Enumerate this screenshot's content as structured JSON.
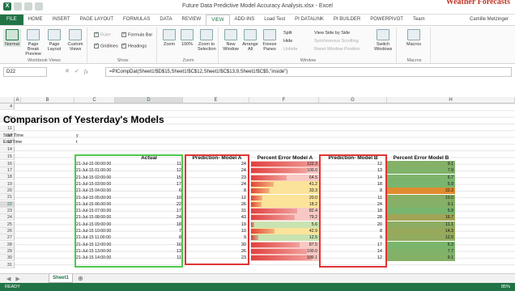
{
  "window": {
    "title": "Future Data Predictive Model Accuracy Analysis.xlsx - Excel",
    "watermark": "Weather Forecasts",
    "user": "Camille Metzinger"
  },
  "ribbon_tabs": [
    "HOME",
    "INSERT",
    "PAGE LAYOUT",
    "FORMULAS",
    "DATA",
    "REVIEW",
    "VIEW",
    "ADD-INS",
    "Load Test",
    "PI DATALINK",
    "PI BUILDER",
    "POWERPIVOT",
    "Team"
  ],
  "file_tab": "FILE",
  "active_tab": "VIEW",
  "ribbon": {
    "workbook_views": {
      "label": "Workbook Views",
      "normal": "Normal",
      "page_break": "Page Break Preview",
      "page_layout": "Page Layout",
      "custom": "Custom Views"
    },
    "show": {
      "label": "Show",
      "ruler": "Ruler",
      "formula_bar": "Formula Bar",
      "gridlines": "Gridlines",
      "headings": "Headings"
    },
    "zoom": {
      "label": "Zoom",
      "zoom": "Zoom",
      "hundred": "100%",
      "selection": "Zoom to Selection"
    },
    "window": {
      "label": "Window",
      "new_window": "New Window",
      "arrange_all": "Arrange All",
      "freeze": "Freeze Panes",
      "split": "Split",
      "hide": "Hide",
      "unhide": "Unhide",
      "side_by_side": "View Side by Side",
      "sync": "Synchronous Scrolling",
      "reset": "Reset Window Position",
      "switch": "Switch Windows"
    },
    "macros": {
      "label": "Macros",
      "macros": "Macros"
    }
  },
  "formula_bar": {
    "name_box": "D22",
    "formula": "=PICompDat(Sheet1!$D$15,Sheet1!$C$12,Sheet1!$C$13,9,Sheet1!$C$5,\"inside\")"
  },
  "columns": [
    "A",
    "B",
    "C",
    "D",
    "E",
    "F",
    "G",
    "H"
  ],
  "row_numbers": [
    "4",
    "10",
    "11",
    "12",
    "13",
    "14",
    "15",
    "16",
    "17",
    "18",
    "19",
    "20",
    "21",
    "22",
    "23",
    "24",
    "25",
    "26",
    "27",
    "28",
    "29",
    "30",
    "31"
  ],
  "sheet": {
    "title": "Comparison of Yesterday's Models",
    "start_label": "Start Time",
    "end_label": "End Time",
    "start_value": "y",
    "end_value": "t",
    "headers": {
      "actual": "Actual",
      "pred_a": "Prediction- Model A",
      "err_a": "Percent Error Model A",
      "pred_b": "Prediction- Model B",
      "err_b": "Percent Error Model B"
    },
    "rows": [
      {
        "ts": "21-Jul-15 00:00:00",
        "actual": "11",
        "pred_a": "24",
        "err_a": "122.3",
        "pred_b": "12",
        "err_b": "9.1"
      },
      {
        "ts": "21-Jul-15 01:00:00",
        "actual": "12",
        "pred_a": "24",
        "err_a": "100.0",
        "pred_b": "13",
        "err_b": "7.9"
      },
      {
        "ts": "21-Jul-15 02:00:00",
        "actual": "15",
        "pred_a": "23",
        "err_a": "64.5",
        "pred_b": "14",
        "err_b": "6.7"
      },
      {
        "ts": "21-Jul-15 03:00:00",
        "actual": "17",
        "pred_a": "24",
        "err_a": "41.2",
        "pred_b": "18",
        "err_b": "5.9"
      },
      {
        "ts": "21-Jul-15 04:00:00",
        "actual": "6",
        "pred_a": "8",
        "err_a": "33.3",
        "pred_b": "8",
        "err_b": "33.3"
      },
      {
        "ts": "21-Jul-15 05:00:00",
        "actual": "10",
        "pred_a": "12",
        "err_a": "20.0",
        "pred_b": "11",
        "err_b": "10.0"
      },
      {
        "ts": "21-Jul-15 06:00:00",
        "actual": "22",
        "pred_a": "26",
        "err_a": "18.2",
        "pred_b": "24",
        "err_b": "9.1"
      },
      {
        "ts": "21-Jul-15 07:00:00",
        "actual": "17",
        "pred_a": "31",
        "err_a": "82.4",
        "pred_b": "18",
        "err_b": "5.9"
      },
      {
        "ts": "21-Jul-15 08:00:00",
        "actual": "24",
        "pred_a": "43",
        "err_a": "79.2",
        "pred_b": "28",
        "err_b": "16.7"
      },
      {
        "ts": "21-Jul-15 09:00:00",
        "actual": "18",
        "pred_a": "19",
        "err_a": "5.6",
        "pred_b": "20",
        "err_b": "11.1"
      },
      {
        "ts": "21-Jul-15 10:00:00",
        "actual": "7",
        "pred_a": "10",
        "err_a": "42.9",
        "pred_b": "8",
        "err_b": "14.3"
      },
      {
        "ts": "21-Jul-15 11:00:00",
        "actual": "8",
        "pred_a": "9",
        "err_a": "12.5",
        "pred_b": "9",
        "err_b": "12.5"
      },
      {
        "ts": "21-Jul-15 12:00:00",
        "actual": "16",
        "pred_a": "30",
        "err_a": "87.5",
        "pred_b": "17",
        "err_b": "6.3"
      },
      {
        "ts": "21-Jul-15 13:00:00",
        "actual": "13",
        "pred_a": "26",
        "err_a": "100.0",
        "pred_b": "14",
        "err_b": "7.7"
      },
      {
        "ts": "21-Jul-15 14:00:00",
        "actual": "11",
        "pred_a": "23",
        "err_a": "109.1",
        "pred_b": "12",
        "err_b": "9.1"
      }
    ]
  },
  "sheet_tab": "Sheet1",
  "status": "READY",
  "zoom_level": "85%",
  "colors": {
    "excel_green": "#217346",
    "actual_border": "#4fc84f",
    "prediction_border": "#e03434"
  }
}
